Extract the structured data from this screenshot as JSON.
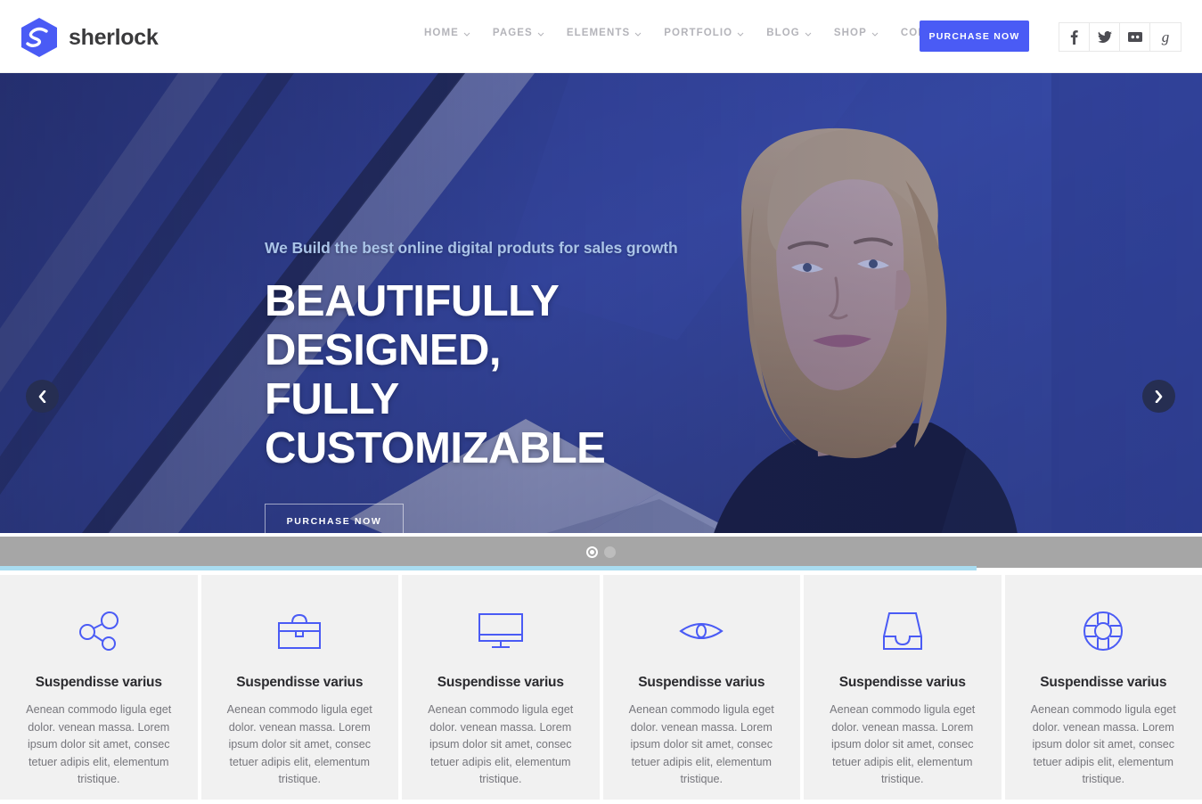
{
  "brand": {
    "name": "sherlock",
    "logo_icon": "hexagon-s-logo-icon",
    "color": "#4a5bf5"
  },
  "header": {
    "nav": [
      {
        "label": "HOME",
        "icon": "chevron-down-icon"
      },
      {
        "label": "PAGES",
        "icon": "chevron-down-icon"
      },
      {
        "label": "ELEMENTS",
        "icon": "chevron-down-icon"
      },
      {
        "label": "PORTFOLIO",
        "icon": "chevron-down-icon"
      },
      {
        "label": "BLOG",
        "icon": "chevron-down-icon"
      },
      {
        "label": "SHOP",
        "icon": "chevron-down-icon"
      },
      {
        "label": "CONTACT",
        "icon": "chevron-down-icon"
      }
    ],
    "purchase_label": "PURCHASE NOW",
    "socials": [
      {
        "name": "facebook-icon"
      },
      {
        "name": "twitter-icon"
      },
      {
        "name": "flickr-icon"
      },
      {
        "name": "google-plus-icon"
      }
    ]
  },
  "hero": {
    "subtitle": "We Build the best online digital produts for sales growth",
    "title_lines": [
      "BEAUTIFULLY",
      "DESIGNED, FULLY",
      "CUSTOMIZABLE"
    ],
    "cta_label": "PURCHASE NOW",
    "prev_icon": "chevron-left-icon",
    "next_icon": "chevron-right-icon",
    "slides": [
      {
        "label": "slide-1",
        "active": true
      },
      {
        "label": "slide-2",
        "active": false
      }
    ],
    "subtitle_color": "#aac4e8",
    "accent_color": "#a9dcf0"
  },
  "features": {
    "body": "Aenean commodo ligula eget dolor. venean massa. Lorem ipsum dolor sit amet, consec tetuer adipis elit, elementum tristique.",
    "items": [
      {
        "icon": "share-network-icon",
        "title": "Suspendisse varius",
        "text": "Aenean commodo ligula eget dolor. venean massa. Lorem ipsum dolor sit amet, consec tetuer adipis elit, elementum tristique."
      },
      {
        "icon": "briefcase-icon",
        "title": "Suspendisse varius",
        "text": "Aenean commodo ligula eget dolor. venean massa. Lorem ipsum dolor sit amet, consec tetuer adipis elit, elementum tristique."
      },
      {
        "icon": "monitor-icon",
        "title": "Suspendisse varius",
        "text": "Aenean commodo ligula eget dolor. venean massa. Lorem ipsum dolor sit amet, consec tetuer adipis elit, elementum tristique."
      },
      {
        "icon": "eye-icon",
        "title": "Suspendisse varius",
        "text": "Aenean commodo ligula eget dolor. venean massa. Lorem ipsum dolor sit amet, consec tetuer adipis elit, elementum tristique."
      },
      {
        "icon": "inbox-icon",
        "title": "Suspendisse varius",
        "text": "Aenean commodo ligula eget dolor. venean massa. Lorem ipsum dolor sit amet, consec tetuer adipis elit, elementum tristique."
      },
      {
        "icon": "life-buoy-icon",
        "title": "Suspendisse varius",
        "text": "Aenean commodo ligula eget dolor. venean massa. Lorem ipsum dolor sit amet, consec tetuer adipis elit, elementum tristique."
      }
    ],
    "icon_color": "#4a5bf5"
  }
}
